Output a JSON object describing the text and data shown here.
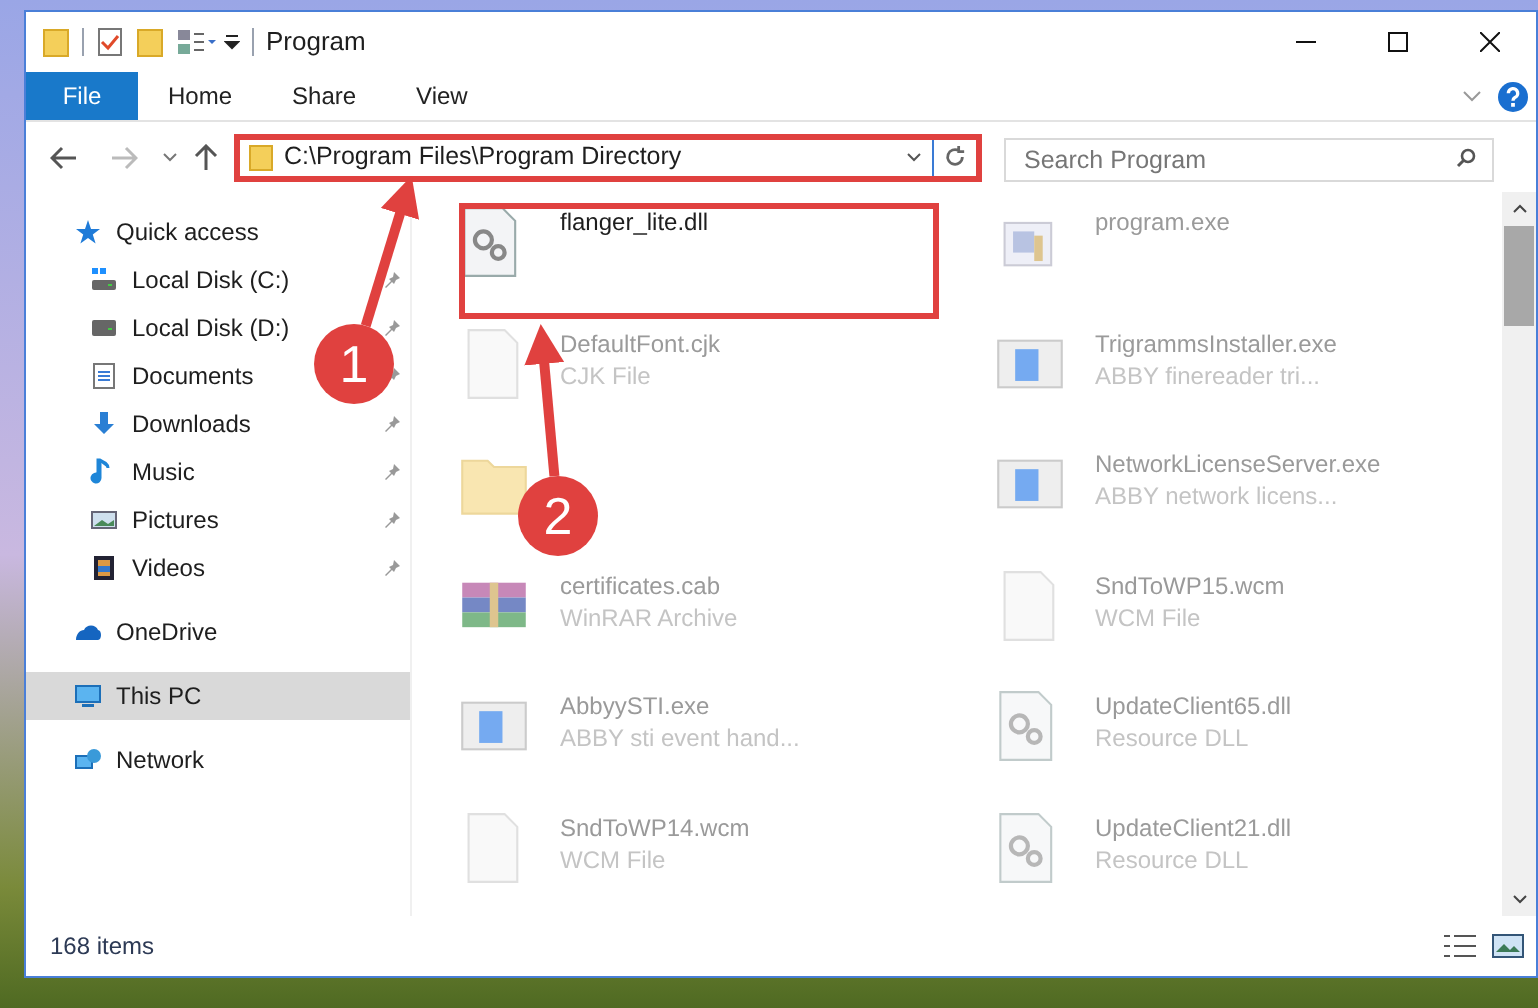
{
  "window": {
    "title": "Program"
  },
  "ribbon_tabs": [
    {
      "label": "File",
      "selected": true
    },
    {
      "label": "Home",
      "selected": false
    },
    {
      "label": "Share",
      "selected": false
    },
    {
      "label": "View",
      "selected": false
    }
  ],
  "address_bar": {
    "path": "C:\\Program Files\\Program Directory"
  },
  "search": {
    "placeholder": "Search Program"
  },
  "nav": [
    {
      "label": "Quick access",
      "selected": false,
      "children": [
        {
          "label": "Local Disk (C:)",
          "pinned": true
        },
        {
          "label": "Local Disk (D:)",
          "pinned": true
        },
        {
          "label": "Documents",
          "pinned": true
        },
        {
          "label": "Downloads",
          "pinned": true
        },
        {
          "label": "Music",
          "pinned": true
        },
        {
          "label": "Pictures",
          "pinned": true
        },
        {
          "label": "Videos",
          "pinned": true
        }
      ]
    },
    {
      "label": "OneDrive",
      "selected": false
    },
    {
      "label": "This PC",
      "selected": true
    },
    {
      "label": "Network",
      "selected": false
    }
  ],
  "files": [
    {
      "kind": "dll",
      "name": "flanger_lite.dll",
      "blurred": false
    },
    {
      "kind": "exe",
      "name": "program.exe",
      "blurred": true
    },
    {
      "kind": "file",
      "name": "DefaultFont.cjk",
      "type": "CJK File",
      "blurred": true
    },
    {
      "kind": "app",
      "name": "TrigrammsInstaller.exe",
      "type": "ABBY finereader tri...",
      "blurred": true
    },
    {
      "kind": "folder",
      "blurred": true
    },
    {
      "kind": "app",
      "name": "NetworkLicenseServer.exe",
      "type": "ABBY network licens...",
      "blurred": true
    },
    {
      "kind": "archive",
      "name": "certificates.cab",
      "type": "WinRAR Archive",
      "blurred": true
    },
    {
      "kind": "file",
      "name": "SndToWP15.wcm",
      "type": "WCM File",
      "blurred": true
    },
    {
      "kind": "app",
      "name": "AbbyySTI.exe",
      "type": "ABBY sti event hand...",
      "blurred": true
    },
    {
      "kind": "dll",
      "name": "UpdateClient65.dll",
      "type": "Resource DLL",
      "blurred": true
    },
    {
      "kind": "file",
      "name": "SndToWP14.wcm",
      "type": "WCM File",
      "blurred": true
    },
    {
      "kind": "dll",
      "name": "UpdateClient21.dll",
      "type": "Resource DLL",
      "blurred": true
    }
  ],
  "status_bar": {
    "item_count": "168 items"
  },
  "annotations": [
    {
      "number": "1"
    },
    {
      "number": "2"
    }
  ]
}
